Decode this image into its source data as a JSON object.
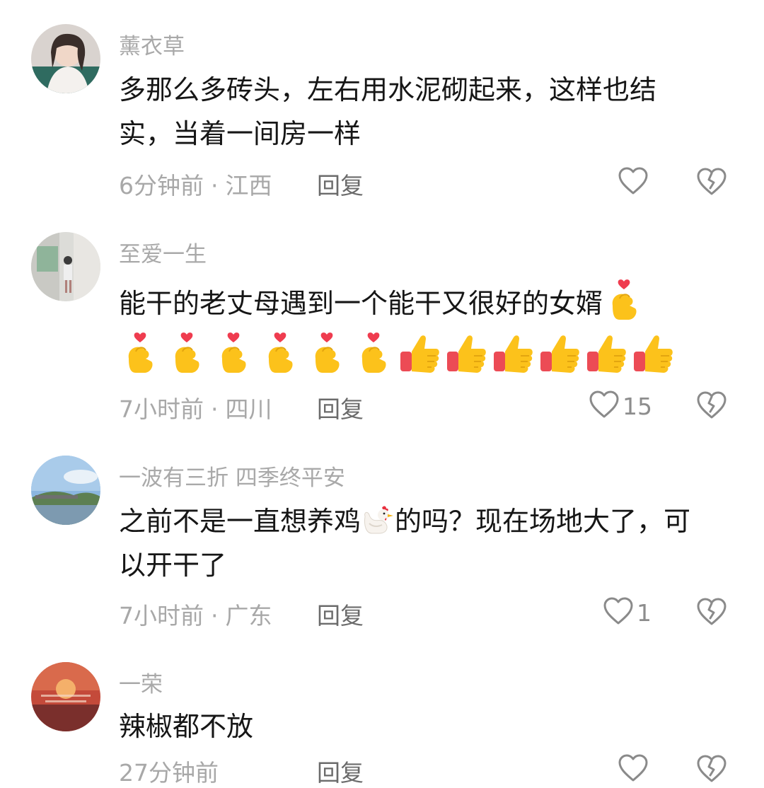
{
  "comments": [
    {
      "username": "薰衣草",
      "content": "多那么多砖头，左右用水泥砌起来，这样也结实，当着一间房一样",
      "time": "6分钟前",
      "location": "江西",
      "reply_label": "回复",
      "likes": ""
    },
    {
      "username": "至爱一生",
      "content": "能干的老丈母遇到一个能干又很好的女婿",
      "emojis_inline": [
        "finger-heart-emoji"
      ],
      "emojis_row": [
        "finger-heart-emoji",
        "finger-heart-emoji",
        "finger-heart-emoji",
        "finger-heart-emoji",
        "finger-heart-emoji",
        "finger-heart-emoji",
        "thumbs-up-emoji",
        "thumbs-up-emoji",
        "thumbs-up-emoji",
        "thumbs-up-emoji",
        "thumbs-up-emoji",
        "thumbs-up-emoji"
      ],
      "time": "7小时前",
      "location": "四川",
      "reply_label": "回复",
      "likes": "15"
    },
    {
      "username": "一波有三折 四季终平安",
      "content_before": "之前不是一直想养鸡",
      "content_emoji": "chicken-emoji",
      "content_after": "的吗？现在场地大了，可以开干了",
      "time": "7小时前",
      "location": "广东",
      "reply_label": "回复",
      "likes": "1"
    },
    {
      "username": "一荣",
      "content": "辣椒都不放",
      "time": "27分钟前",
      "location": "",
      "reply_label": "回复",
      "likes": ""
    }
  ],
  "meta_separator": "·",
  "icons": {
    "like": "heart-outline-icon",
    "dislike": "broken-heart-icon"
  },
  "colors": {
    "username": "#a9a9a9",
    "meta": "#a8a8a8",
    "icon_stroke": "#8a8a8a"
  }
}
